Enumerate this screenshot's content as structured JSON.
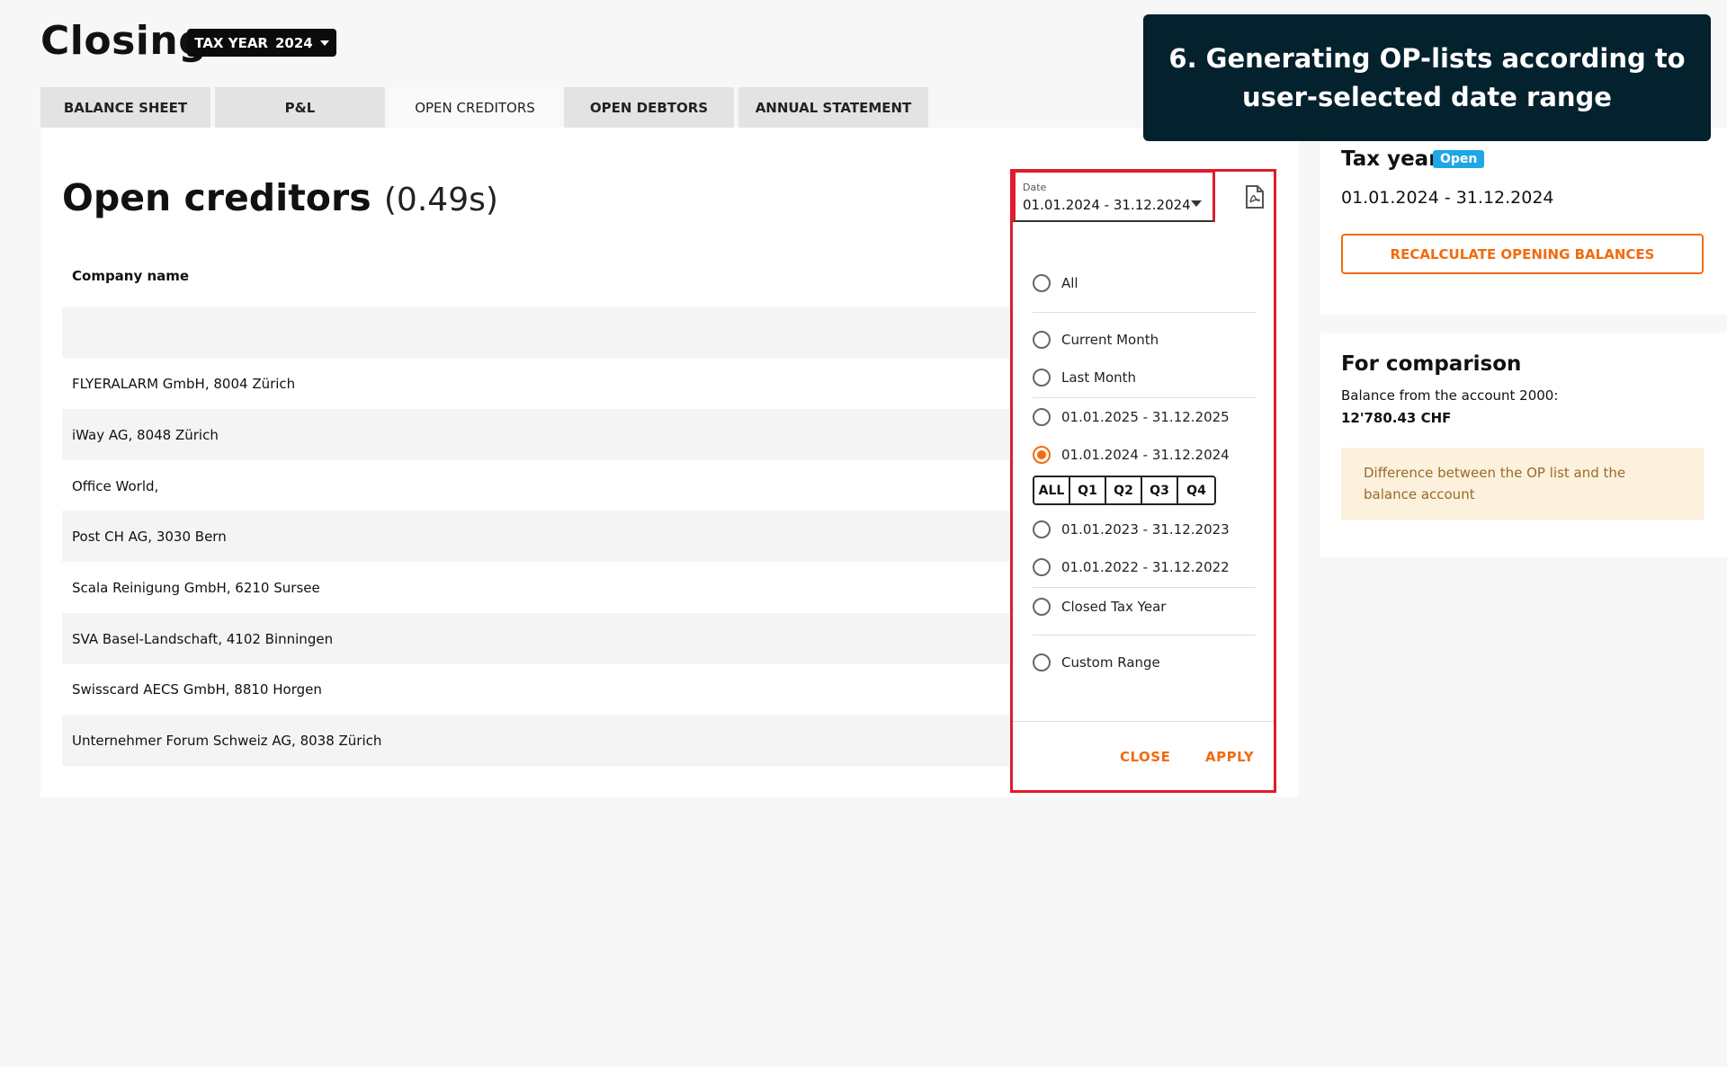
{
  "header": {
    "title": "Closing",
    "tax_year_label": "TAX YEAR",
    "tax_year_value": "2024"
  },
  "tabs": [
    {
      "label": "BALANCE SHEET",
      "active": false
    },
    {
      "label": "P&L",
      "active": false
    },
    {
      "label": "OPEN CREDITORS",
      "active": true
    },
    {
      "label": "OPEN DEBTORS",
      "active": false
    },
    {
      "label": "ANNUAL STATEMENT",
      "active": false
    }
  ],
  "main": {
    "heading": "Open creditors",
    "timing": "(0.49s)",
    "column_header": "Company name",
    "rows": [
      "",
      "FLYERALARM GmbH, 8004 Zürich",
      "iWay AG, 8048 Zürich",
      "Office World,",
      "Post CH AG, 3030 Bern",
      "Scala Reinigung GmbH, 6210 Sursee",
      "SVA Basel-Landschaft, 4102 Binningen",
      "Swisscard AECS GmbH, 8810 Horgen",
      "Unternehmer Forum Schweiz AG, 8038 Zürich"
    ]
  },
  "date_filter": {
    "label": "Date",
    "value": "01.01.2024 - 31.12.2024",
    "options": [
      {
        "label": "All",
        "selected": false
      },
      {
        "label": "Current Month",
        "selected": false
      },
      {
        "label": "Last Month",
        "selected": false
      },
      {
        "label": "01.01.2025 - 31.12.2025",
        "selected": false
      },
      {
        "label": "01.01.2024 - 31.12.2024",
        "selected": true
      },
      {
        "label": "01.01.2023 - 31.12.2023",
        "selected": false
      },
      {
        "label": "01.01.2022 - 31.12.2022",
        "selected": false
      },
      {
        "label": "Closed Tax Year",
        "selected": false
      },
      {
        "label": "Custom Range",
        "selected": false
      }
    ],
    "quarters": [
      "ALL",
      "Q1",
      "Q2",
      "Q3",
      "Q4"
    ],
    "close_label": "CLOSE",
    "apply_label": "APPLY"
  },
  "tax_year_card": {
    "title": "Tax year",
    "status": "Open",
    "range": "01.01.2024 - 31.12.2024",
    "recalc_label": "RECALCULATE OPENING BALANCES"
  },
  "comparison_card": {
    "title": "For comparison",
    "description": "Balance from the account 2000:",
    "value": "12'780.43 CHF",
    "difference_note": "Difference between the OP list and the balance account"
  },
  "tooltip": {
    "text": "6. Generating OP-lists according to user-selected date range"
  },
  "colors": {
    "accent": "#f26b0f",
    "highlight": "#e01b2b",
    "badge": "#1ea7e6",
    "tooltip_bg": "#04212e"
  }
}
